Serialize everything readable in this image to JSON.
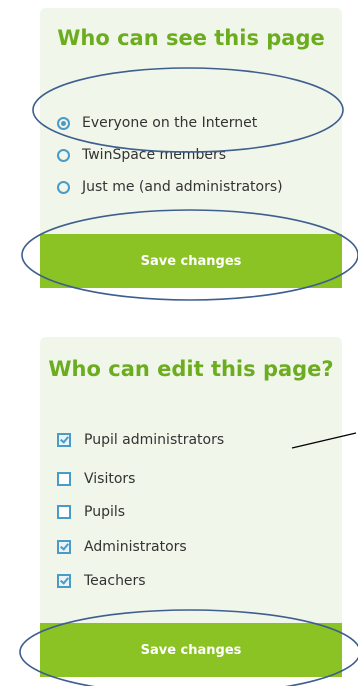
{
  "visibility_panel": {
    "title": "Who can see this page",
    "options": [
      {
        "label": "Everyone on the Internet",
        "selected": true
      },
      {
        "label": "TwinSpace members",
        "selected": false
      },
      {
        "label": "Just me (and administrators)",
        "selected": false
      }
    ],
    "save_label": "Save changes"
  },
  "edit_panel": {
    "title": "Who can edit this page?",
    "options": [
      {
        "label": "Pupil administrators",
        "checked": true
      },
      {
        "label": "Visitors",
        "checked": false
      },
      {
        "label": "Pupils",
        "checked": false
      },
      {
        "label": "Administrators",
        "checked": true
      },
      {
        "label": "Teachers",
        "checked": true
      }
    ],
    "save_label": "Save changes"
  },
  "colors": {
    "panel_bg": "#f0f6ea",
    "title": "#6cac1f",
    "button": "#8bc224",
    "control": "#4a9bc6",
    "annotation": "#3d5e8f"
  }
}
